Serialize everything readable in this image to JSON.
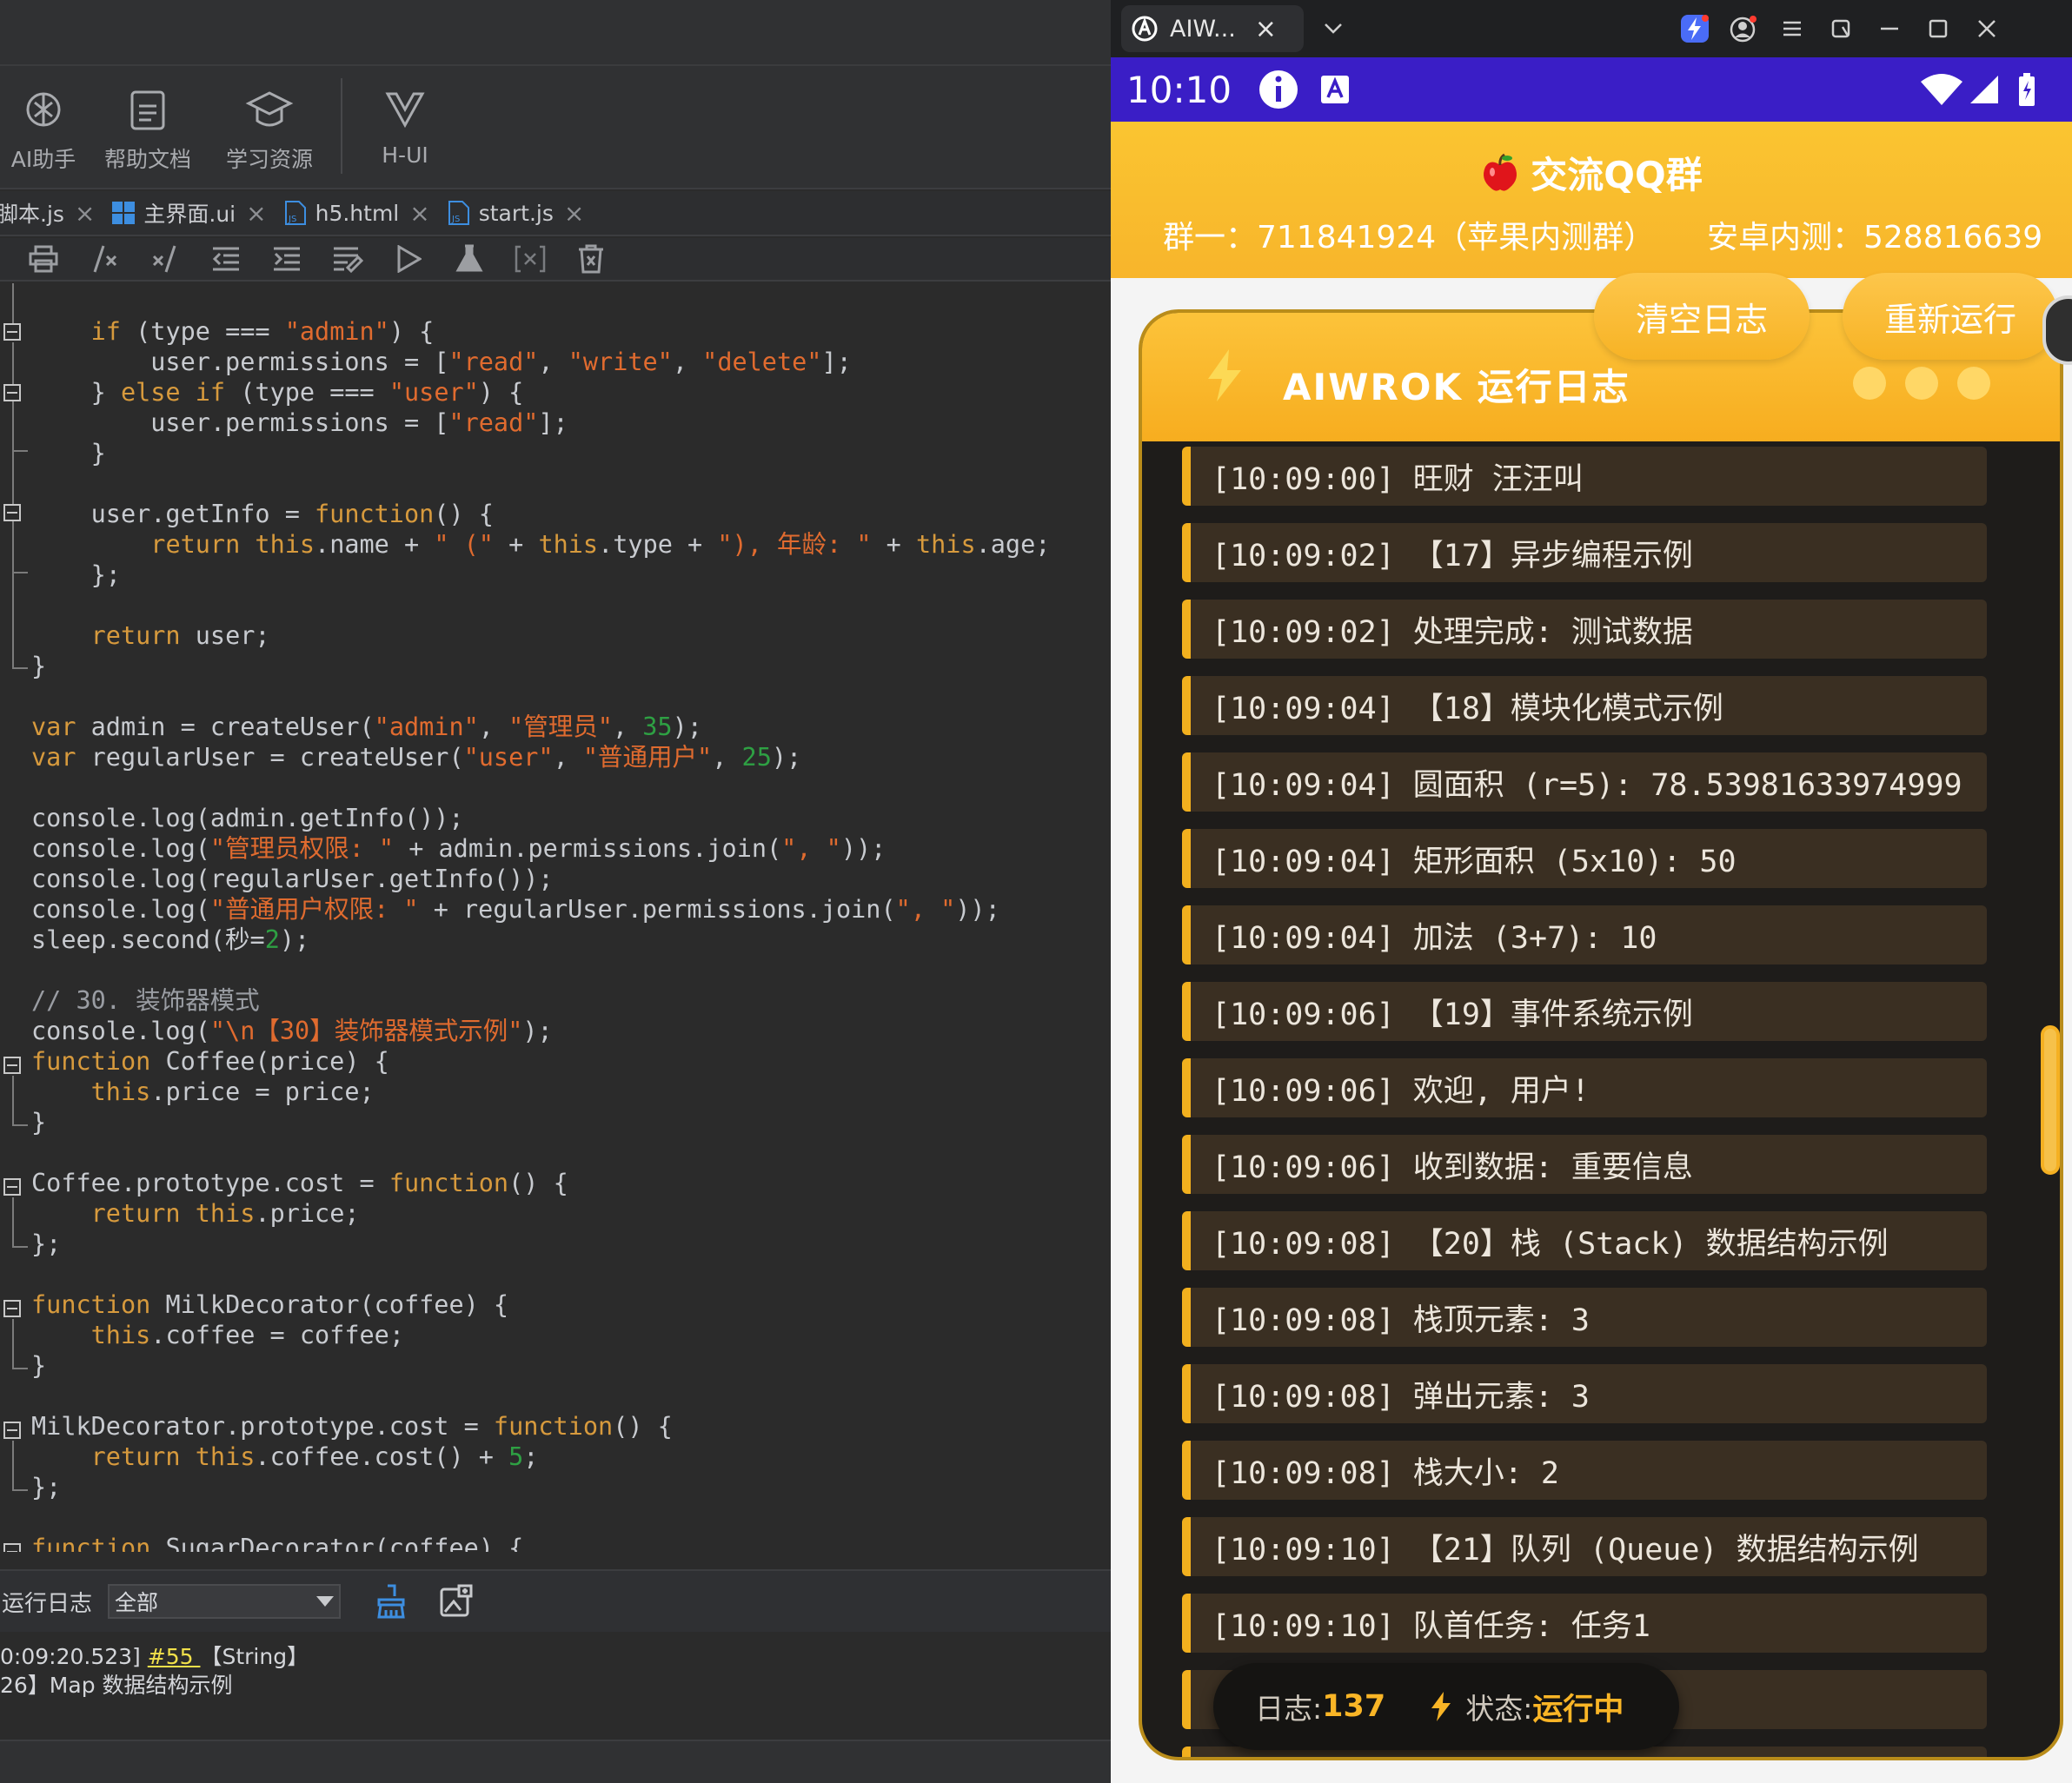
{
  "ide": {
    "toolbar": [
      {
        "label": "AI助手",
        "icon": "ai-assistant-icon"
      },
      {
        "label": "帮助文档",
        "icon": "help-doc-icon"
      },
      {
        "label": "学习资源",
        "icon": "learning-resource-icon"
      },
      {
        "label": "H-UI",
        "icon": "h-ui-icon"
      }
    ],
    "tabs": [
      {
        "label": "脚本.js",
        "icon": "js-file-icon"
      },
      {
        "label": "主界面.ui",
        "icon": "ui-grid-icon"
      },
      {
        "label": "h5.html",
        "icon": "js-file-icon"
      },
      {
        "label": "start.js",
        "icon": "js-file-icon"
      }
    ],
    "actions": [
      "print-icon",
      "comment-icon",
      "uncomment-icon",
      "outdent-icon",
      "indent-icon",
      "format-icon",
      "run-icon",
      "test-flask-icon",
      "variable-icon",
      "clear-icon"
    ],
    "code_lines": [
      "    if (type === \"admin\") {",
      "        user.permissions = [\"read\", \"write\", \"delete\"];",
      "    } else if (type === \"user\") {",
      "        user.permissions = [\"read\"];",
      "    }",
      "",
      "    user.getInfo = function() {",
      "        return this.name + \" (\" + this.type + \"), 年龄: \" + this.age;",
      "    };",
      "",
      "    return user;",
      "}",
      "",
      "var admin = createUser(\"admin\", \"管理员\", 35);",
      "var regularUser = createUser(\"user\", \"普通用户\", 25);",
      "",
      "console.log(admin.getInfo());",
      "console.log(\"管理员权限: \" + admin.permissions.join(\", \"));",
      "console.log(regularUser.getInfo());",
      "console.log(\"普通用户权限: \" + regularUser.permissions.join(\", \"));",
      "sleep.second(秒=2);",
      "",
      "// 30. 装饰器模式",
      "console.log(\"\\n【30】装饰器模式示例\");",
      "function Coffee(price) {",
      "    this.price = price;",
      "}",
      "",
      "Coffee.prototype.cost = function() {",
      "    return this.price;",
      "};",
      "",
      "function MilkDecorator(coffee) {",
      "    this.coffee = coffee;",
      "}",
      "",
      "MilkDecorator.prototype.cost = function() {",
      "    return this.coffee.cost() + 5;",
      "};",
      "",
      "function SugarDecorator(coffee) {"
    ],
    "log": {
      "label": "运行日志",
      "filter": "全部",
      "line1_prefix": "0:09:20.523] ",
      "line1_link": "#55 ",
      "line1_suffix": "【String】",
      "line2": "26】Map 数据结构示例"
    }
  },
  "browser": {
    "tab_title": "AIW...",
    "close": "×"
  },
  "phone": {
    "time": "10:10",
    "qq": {
      "title": "交流QQ群",
      "group1": "群一：711841924（苹果内测群）",
      "group2": "安卓内测：528816639"
    },
    "buttons": {
      "clear": "清空日志",
      "rerun": "重新运行"
    },
    "panel_title": "AIWROK 运行日志",
    "entries": [
      "[10:09:00] 旺财 汪汪叫",
      "[10:09:02] 【17】异步编程示例",
      "[10:09:02] 处理完成: 测试数据",
      "[10:09:04] 【18】模块化模式示例",
      "[10:09:04] 圆面积 (r=5): 78.53981633974999",
      "[10:09:04] 矩形面积 (5x10): 50",
      "[10:09:04] 加法 (3+7): 10",
      "[10:09:06] 【19】事件系统示例",
      "[10:09:06] 欢迎, 用户!",
      "[10:09:06] 收到数据: 重要信息",
      "[10:09:08] 【20】栈 (Stack) 数据结构示例",
      "[10:09:08] 栈顶元素: 3",
      "[10:09:08] 弹出元素: 3",
      "[10:09:08] 栈大小: 2",
      "[10:09:10] 【21】队列 (Queue) 数据结构示例",
      "[10:09:10] 队首任务: 任务1",
      "",
      ""
    ],
    "status": {
      "log_label": "日志: ",
      "log_count": "137",
      "state_label": "状态: ",
      "state_value": "运行中"
    }
  },
  "colors": {
    "accent": "#f8b52b",
    "status_bar": "#3a1ec6",
    "panel_bg": "#1e1c1a",
    "entry_bg": "#3a2f22",
    "keyword": "#d79a3d",
    "string": "#e06b2f",
    "number": "#2ea043"
  }
}
